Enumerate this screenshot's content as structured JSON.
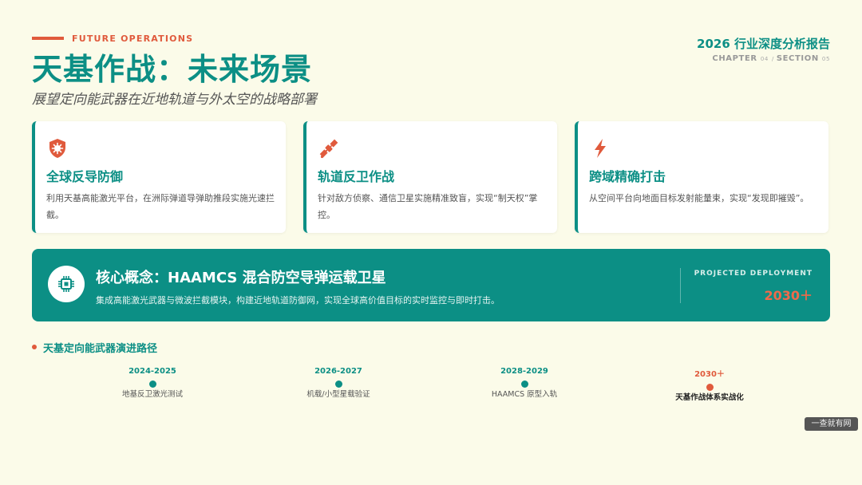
{
  "header": {
    "eyebrow": "FUTURE OPERATIONS",
    "title": "天基作战：未来场景",
    "subtitle": "展望定向能武器在近地轨道与外太空的战略部署",
    "report": "2026 行业深度分析报告",
    "chapter_label": "CHAPTER",
    "chapter_num": "04",
    "section_label": "SECTION",
    "section_num": "05"
  },
  "cards": [
    {
      "icon": "shield-virus-icon",
      "title": "全球反导防御",
      "desc": "利用天基高能激光平台，在洲际弹道导弹助推段实施光速拦截。"
    },
    {
      "icon": "satellite-icon",
      "title": "轨道反卫作战",
      "desc": "针对敌方侦察、通信卫星实施精准致盲，实现“制天权”掌控。"
    },
    {
      "icon": "lightning-icon",
      "title": "跨域精确打击",
      "desc": "从空间平台向地面目标发射能量束，实现“发现即摧毁”。"
    }
  ],
  "banner": {
    "icon": "microchip-icon",
    "title": "核心概念：HAAMCS 混合防空导弹运载卫星",
    "desc": "集成高能激光武器与微波拦截模块，构建近地轨道防御网，实现全球高价值目标的实时监控与即时打击。",
    "projected_label": "PROJECTED DEPLOYMENT",
    "projected_year": "2030＋"
  },
  "timeline": {
    "title": "天基定向能武器演进路径",
    "items": [
      {
        "year": "2024-2025",
        "label": "地基反卫激光测试"
      },
      {
        "year": "2026-2027",
        "label": "机载/小型星载验证"
      },
      {
        "year": "2028-2029",
        "label": "HAAMCS 原型入轨"
      },
      {
        "year": "2030＋",
        "label": "天基作战体系实战化"
      }
    ]
  },
  "watermark": "一查就有网",
  "colors": {
    "primary": "#0c8f85",
    "accent": "#e05a3c",
    "background": "#fbfbe9"
  }
}
